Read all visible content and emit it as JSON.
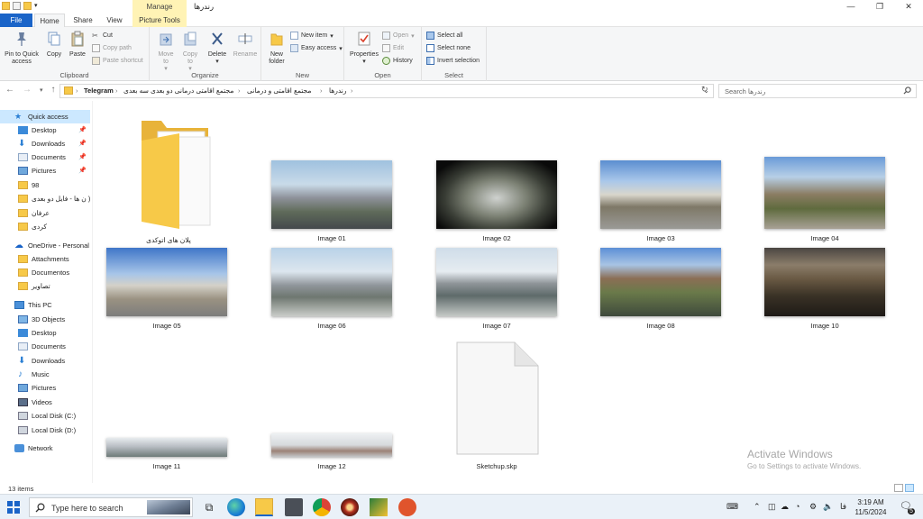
{
  "window": {
    "title": "رندرها",
    "manage_tab": "Manage",
    "minimize": "—",
    "maximize": "❐",
    "close": "✕"
  },
  "tabs": {
    "file": "File",
    "home": "Home",
    "share": "Share",
    "view": "View",
    "picture_tools": "Picture Tools"
  },
  "ribbon": {
    "clipboard": {
      "label": "Clipboard",
      "pin": "Pin to Quick access",
      "copy": "Copy",
      "paste": "Paste",
      "cut": "Cut",
      "copy_path": "Copy path",
      "paste_shortcut": "Paste shortcut"
    },
    "organize": {
      "label": "Organize",
      "move_to": "Move to",
      "copy_to": "Copy to",
      "delete": "Delete",
      "rename": "Rename"
    },
    "new": {
      "label": "New",
      "new_folder": "New folder",
      "new_item": "New item",
      "easy_access": "Easy access"
    },
    "open": {
      "label": "Open",
      "properties": "Properties",
      "open": "Open",
      "edit": "Edit",
      "history": "History"
    },
    "select": {
      "label": "Select",
      "select_all": "Select all",
      "select_none": "Select none",
      "invert": "Invert selection"
    }
  },
  "address": {
    "crumbs": [
      "Telegram",
      "مجتمع اقامتی درمانی دو بعدی سه بعدی",
      "مجتمع اقامتی و درمانی",
      "رندرها"
    ],
    "search_placeholder": "Search رندرها"
  },
  "nav": {
    "quick_access": "Quick access",
    "qa_items": [
      "Desktop",
      "Downloads",
      "Documents",
      "Pictures",
      "98",
      "ن ها - فایل دو بعدی )",
      "عرفان",
      "کردی"
    ],
    "onedrive": "OneDrive - Personal",
    "od_items": [
      "Attachments",
      "Documentos",
      "تصاویر"
    ],
    "this_pc": "This PC",
    "pc_items": [
      "3D Objects",
      "Desktop",
      "Documents",
      "Downloads",
      "Music",
      "Pictures",
      "Videos",
      "Local Disk (C:)",
      "Local Disk (D:)"
    ],
    "network": "Network"
  },
  "files": [
    {
      "name": "پلان های اتوکدی",
      "type": "folder"
    },
    {
      "name": "Image 01",
      "type": "image"
    },
    {
      "name": "Image 02",
      "type": "image"
    },
    {
      "name": "Image 03",
      "type": "image"
    },
    {
      "name": "Image 04",
      "type": "image"
    },
    {
      "name": "Image 05",
      "type": "image"
    },
    {
      "name": "Image 06",
      "type": "image"
    },
    {
      "name": "Image 07",
      "type": "image"
    },
    {
      "name": "Image 08",
      "type": "image"
    },
    {
      "name": "Image 10",
      "type": "image"
    },
    {
      "name": "Image 11",
      "type": "image"
    },
    {
      "name": "Image 12",
      "type": "image"
    },
    {
      "name": "Sketchup.skp",
      "type": "file"
    }
  ],
  "status": {
    "count": "13 items"
  },
  "watermark": {
    "line1": "Activate Windows",
    "line2": "Go to Settings to activate Windows."
  },
  "taskbar": {
    "search_placeholder": "Type here to search",
    "language": "فا",
    "time": "3:19 AM",
    "date": "11/5/2024",
    "notification_count": "5"
  },
  "colors": {
    "accent": "#1a64c8",
    "selection": "#cce8ff",
    "folder": "#f7c948"
  }
}
